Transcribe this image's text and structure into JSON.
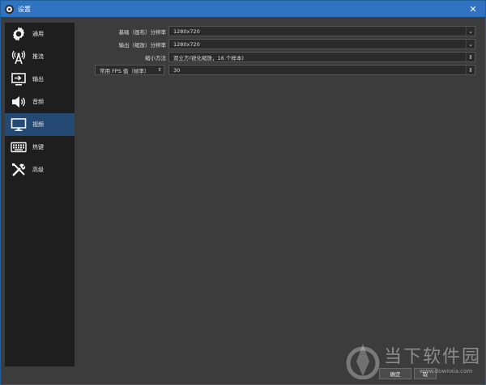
{
  "window": {
    "title": "设置",
    "close_glyph": "✕"
  },
  "sidebar": {
    "items": [
      {
        "label": "通用",
        "icon": "gear-icon"
      },
      {
        "label": "推流",
        "icon": "antenna-icon"
      },
      {
        "label": "输出",
        "icon": "output-icon"
      },
      {
        "label": "音频",
        "icon": "speaker-icon"
      },
      {
        "label": "视频",
        "icon": "monitor-icon",
        "active": true
      },
      {
        "label": "热键",
        "icon": "keyboard-icon"
      },
      {
        "label": "高级",
        "icon": "tools-icon"
      }
    ]
  },
  "video": {
    "base_resolution": {
      "label": "基础（画布）分辨率",
      "value": "1280x720"
    },
    "output_resolution": {
      "label": "输出（缩放）分辨率",
      "value": "1280x720"
    },
    "downscale_filter": {
      "label": "缩小方法",
      "value": "双立方(锐化缩放，16 个样本)"
    },
    "fps": {
      "type_label": "常用 FPS 值（帧率）",
      "value": "30"
    }
  },
  "buttons": {
    "ok": "确定",
    "cancel": "取"
  },
  "watermark": {
    "text": "当下软件园",
    "url": "www.downxia.com"
  },
  "colors": {
    "titlebar": "#2f73c2",
    "sidebar": "#1e1e1e",
    "active_item": "#244a73",
    "background": "#3c3c3c"
  }
}
